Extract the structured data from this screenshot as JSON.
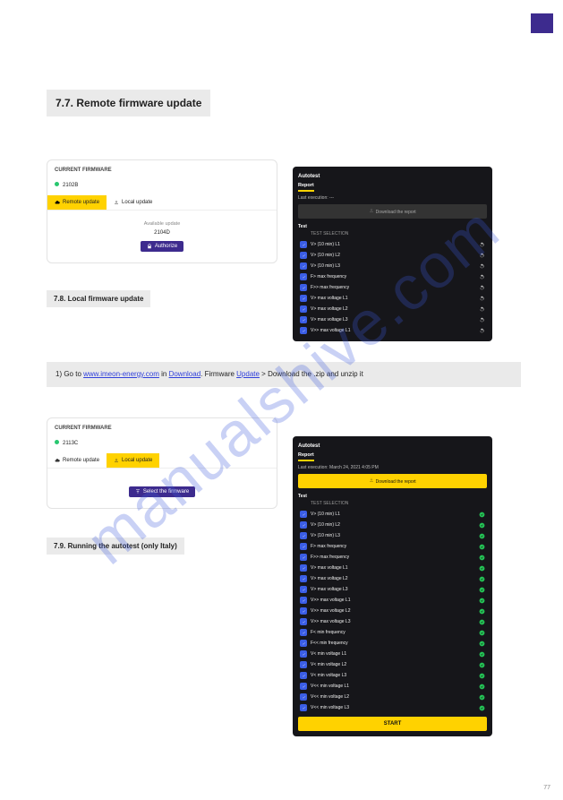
{
  "page": {
    "number": "77"
  },
  "watermark": "manualshive.com",
  "h_mainUpdate": "7.7. Remote firmware update",
  "panel1": {
    "title": "CURRENT FIRMWARE",
    "version": "2102B",
    "tabRemote": "Remote update",
    "tabLocal": "Local update",
    "available": "Available update",
    "availVer": "2104D",
    "authorize": "Authorize"
  },
  "h_localUpdate": "7.8. Local firmware update",
  "proc": {
    "p1a": "1) Go to ",
    "link1": "www.imeon-energy.com",
    "p1b": " in ",
    "link2": "Download",
    "p1c": ". Firmware ",
    "link3": "Update",
    "p1d": " > Download the .zip and unzip it"
  },
  "panel2": {
    "title": "CURRENT FIRMWARE",
    "version": "2113C",
    "tabRemote": "Remote update",
    "tabLocal": "Local update",
    "select": "Select the firmware"
  },
  "h_autotest": "7.9. Running the autotest (only Italy)",
  "dark1": {
    "hd": "Autotest",
    "rp": "Report",
    "lePrefix": "Last execution: ",
    "leVal": "---",
    "dl": "Download the report",
    "tt": "Test",
    "th": "TEST SELECTION",
    "tests": [
      "V> (10 min) L1",
      "V> (10 min) L2",
      "V> (10 min) L3",
      "F> max frequency",
      "F>> max frequency",
      "V> max voltage L1",
      "V> max voltage L2",
      "V> max voltage L3",
      "V>> max voltage L1"
    ]
  },
  "dark2": {
    "hd": "Autotest",
    "rp": "Report",
    "lePrefix": "Last execution: ",
    "leVal": "March 24, 2021 4:05 PM",
    "dl": "Download the report",
    "tt": "Test",
    "th": "TEST SELECTION",
    "tests": [
      "V> (10 min) L1",
      "V> (10 min) L2",
      "V> (10 min) L3",
      "F> max frequency",
      "F>> max frequency",
      "V> max voltage L1",
      "V> max voltage L2",
      "V> max voltage L3",
      "V>> max voltage L1",
      "V>> max voltage L2",
      "V>> max voltage L3",
      "F< min frequency",
      "F<< min frequency",
      "V< min voltage L1",
      "V< min voltage L2",
      "V< min voltage L3",
      "V<< min voltage L1",
      "V<< min voltage L2",
      "V<< min voltage L3"
    ],
    "start": "START"
  }
}
